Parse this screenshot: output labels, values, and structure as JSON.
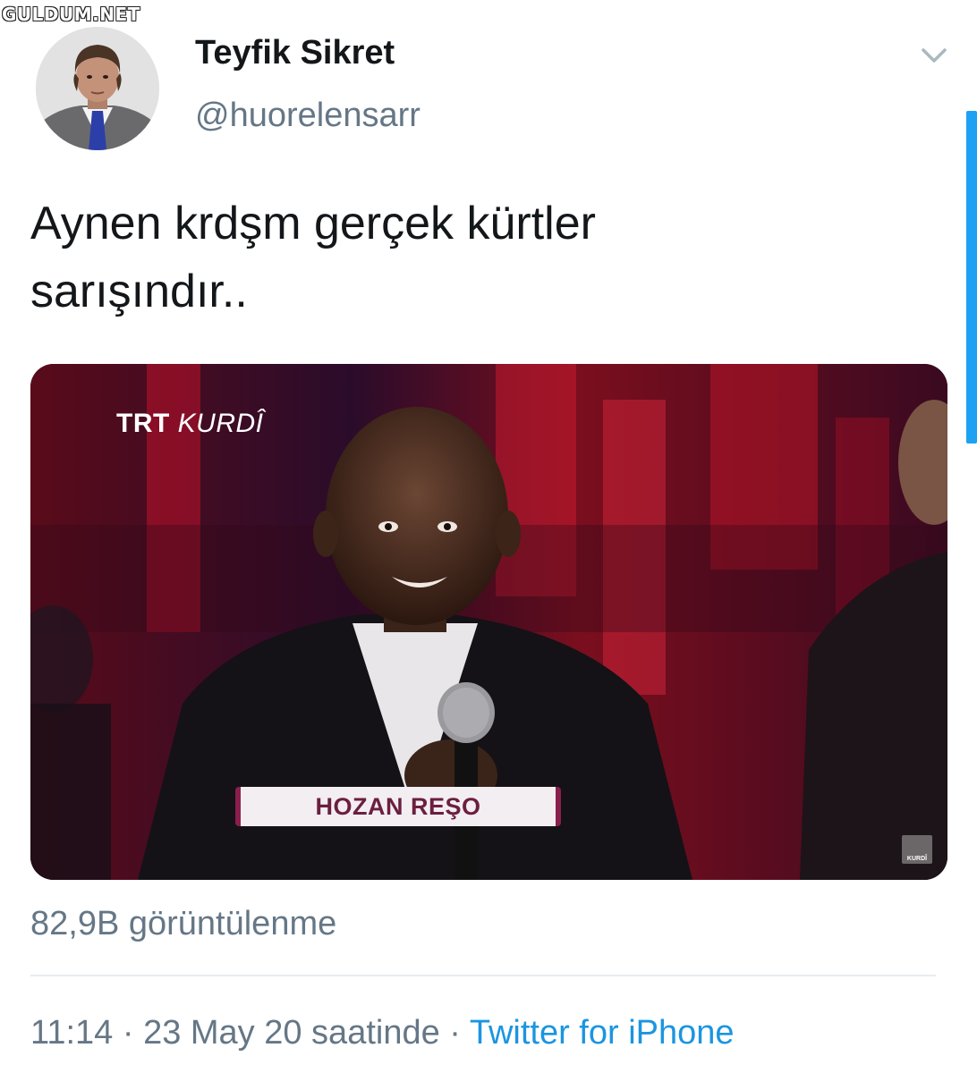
{
  "watermark": "GULDUM.NET",
  "tweet": {
    "display_name": "Teyfik Sikret",
    "handle": "@huorelensarr",
    "text_line1": "Aynen krdşm gerçek kürtler",
    "text_line2": "sarışındır..",
    "views": "82,9B görüntülenme",
    "time": "11:14",
    "separator": "·",
    "date_suffix": "23 May 20 saatinde",
    "source": "Twitter for iPhone"
  },
  "media": {
    "channel_brand": "TRT",
    "channel_sub": "KURDÎ",
    "lower_third_name": "HOZAN REŞO",
    "corner_logo_text": "KURDÎ"
  },
  "icons": {
    "caret": "chevron-down-icon",
    "avatar": "avatar-image"
  },
  "colors": {
    "link": "#1b95e0",
    "secondary_text": "#657786",
    "primary_text": "#14171a",
    "divider": "#e6ecf0",
    "scrollbar": "#1da1f2"
  }
}
